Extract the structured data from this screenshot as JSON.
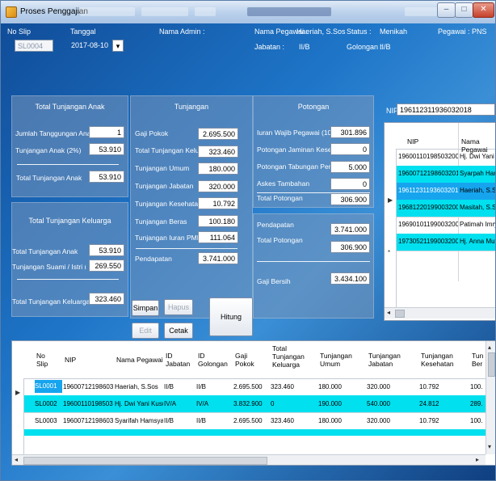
{
  "window": {
    "title": "Proses Penggajian",
    "controls": [
      "–",
      "□",
      "✕"
    ]
  },
  "header": {
    "no_slip_label": "No Slip",
    "no_slip_value": "SL0004",
    "tanggal_label": "Tanggal",
    "tanggal_value": "2017-08-10",
    "nama_admin_label": "Nama Admin :",
    "nama_pegawai_label": "Nama Pegawai :",
    "nama_pegawai_value": "Haeriah, S.Sos",
    "jabatan_label": "Jabatan :",
    "jabatan_value": "II/B",
    "status_label": "Status :",
    "status_value": "Menikah",
    "pegawai_label": "Pegawai :",
    "pegawai_value": "PNS",
    "golongan_label": "Golongan :",
    "golongan_value": "II/B"
  },
  "tunjangan_anak": {
    "title": "Total Tunjangan Anak",
    "jumlah_label": "Jumlah Tanggungan Anak",
    "jumlah_value": "1",
    "tunj_label": "Tunjangan Anak (2%)",
    "tunj_value": "53.910",
    "total_label": "Total Tunjangan Anak",
    "total_value": "53.910"
  },
  "tunjangan_keluarga": {
    "title": "Total Tunjangan Keluarga",
    "anak_label": "Total Tunjangan Anak",
    "anak_value": "53.910",
    "suami_label": "Tunjangan Suami / Istri (10%)",
    "suami_value": "269.550",
    "total_label": "Total Tunjangan Keluarga",
    "total_value": "323.460"
  },
  "tunjangan": {
    "title": "Tunjangan",
    "rows": [
      {
        "label": "Gaji Pokok",
        "value": "2.695.500"
      },
      {
        "label": "Total Tunjangan Keluarga",
        "value": "323.460"
      },
      {
        "label": "Tunjangan Umum",
        "value": "180.000"
      },
      {
        "label": "Tunjangan Jabatan",
        "value": "320.000"
      },
      {
        "label": "Tunjangan Kesehatan",
        "value": "10.792"
      },
      {
        "label": "Tunjangan Beras",
        "value": "100.180"
      },
      {
        "label": "Tunjangan Iuran PMD",
        "value": "111.064"
      }
    ],
    "pendapatan_label": "Pendapatan",
    "pendapatan_value": "3.741.000"
  },
  "potongan": {
    "title": "Potongan",
    "rows": [
      {
        "label": "Iuran Wajib Pegawai (10%)",
        "value": "301.896"
      },
      {
        "label": "Potongan Jaminan Kesehatan",
        "value": "0"
      },
      {
        "label": "Potongan Tabungan Perumahan",
        "value": "5.000"
      },
      {
        "label": "Askes Tambahan",
        "value": "0"
      }
    ],
    "total_label": "Total Potongan",
    "total_value": "306.900"
  },
  "gaji": {
    "pendapatan_label": "Pendapatan",
    "pendapatan_value": "3.741.000",
    "potongan_label": "Total Potongan",
    "potongan_value": "306.900",
    "bersih_label": "Gaji Bersih",
    "bersih_value": "3.434.100"
  },
  "buttons": {
    "simpan": "Simpan",
    "hapus": "Hapus",
    "edit": "Edit",
    "cetak": "Cetak",
    "hitung": "Hitung"
  },
  "nip_search": {
    "label": "NIP",
    "value": "196112311936032018"
  },
  "side_grid": {
    "columns": [
      "NIP",
      "Nama Pegawai"
    ],
    "rows": [
      {
        "nip": "196001101985032009",
        "nama": "Hj. Dwi Yani Ku",
        "highlight": false
      },
      {
        "nip": "196007121986032018",
        "nama": "Syarpah Hamsy",
        "highlight": true
      },
      {
        "nip": "196112311936032018",
        "nama": "Haeriah, S.Sos",
        "highlight": true
      },
      {
        "nip": "196812201990032008",
        "nama": "Masitah, S.Sos",
        "highlight": true
      },
      {
        "nip": "196901011990032005",
        "nama": "Patimah Imry, S.",
        "highlight": false
      },
      {
        "nip": "197305211990032005",
        "nama": "Hj. Anna Mutay",
        "highlight": true
      }
    ]
  },
  "main_grid": {
    "columns": [
      "No Slip",
      "NIP",
      "Nama Pegawai",
      "ID Jabatan",
      "ID Golongan",
      "Gaji Pokok",
      "Total Tunjangan Keluarga",
      "Tunjangan Umum",
      "Tunjangan Jabatan",
      "Tunjangan Kesehatan",
      "Tun Ber"
    ],
    "rows": [
      {
        "cells": [
          "SL0001",
          "196007121986032018",
          "Haeriah, S.Sos",
          "II/B",
          "II/B",
          "2.695.500",
          "323.460",
          "180.000",
          "320.000",
          "10.792",
          "100."
        ],
        "highlight": false
      },
      {
        "cells": [
          "SL0002",
          "196001101985032009",
          "Hj. Dwi Yani Kusuma,",
          "IV/A",
          "IV/A",
          "3.832.900",
          "0",
          "190.000",
          "540.000",
          "24.812",
          "289."
        ],
        "highlight": true
      },
      {
        "cells": [
          "SL0003",
          "196007121986032018",
          "Syarifah Hamsyah, S.",
          "II/B",
          "II/B",
          "2.695.500",
          "323.460",
          "180.000",
          "320.000",
          "10.792",
          "100."
        ],
        "highlight": false
      }
    ]
  },
  "colors": {
    "highlight": "#00e0ef",
    "selected": "#16a4ee",
    "panel": "#7896b9"
  }
}
